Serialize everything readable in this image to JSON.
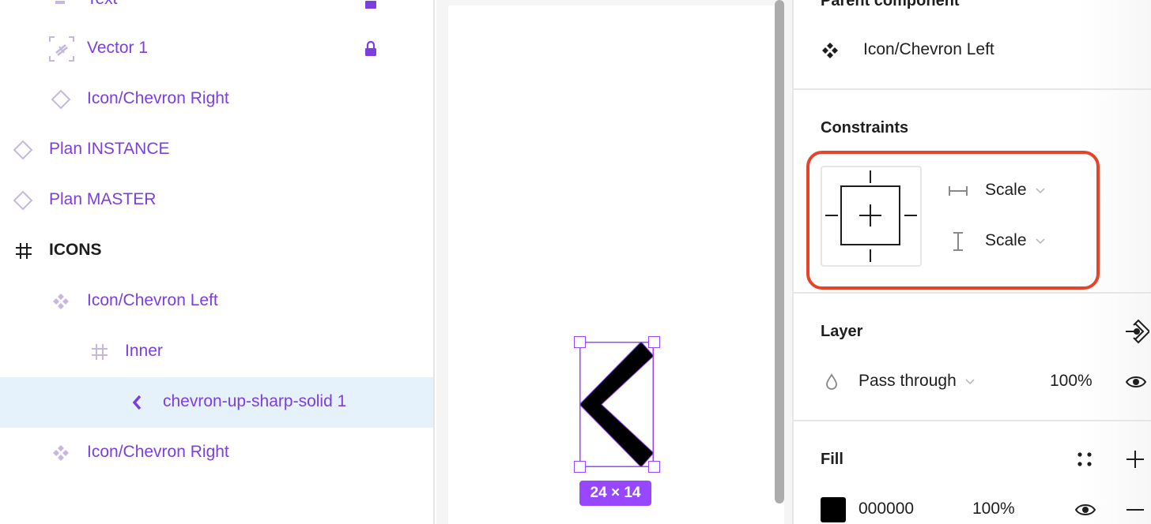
{
  "layers_panel": {
    "items": [
      {
        "label": "Text",
        "icon": "text-layer-icon",
        "locked": true
      },
      {
        "label": "Vector 1",
        "icon": "vector-layer-icon",
        "locked": true
      },
      {
        "label": "Icon/Chevron Right",
        "icon": "instance-icon",
        "locked": false
      },
      {
        "label": "Plan INSTANCE",
        "icon": "instance-icon",
        "locked": false
      },
      {
        "label": "Plan MASTER",
        "icon": "instance-icon",
        "locked": false
      },
      {
        "label": "ICONS",
        "icon": "frame-icon",
        "locked": false
      },
      {
        "label": "Icon/Chevron Left",
        "icon": "component-icon",
        "locked": false
      },
      {
        "label": "Inner",
        "icon": "frame-icon",
        "locked": false
      },
      {
        "label": "chevron-up-sharp-solid 1",
        "icon": "chevron-left-icon",
        "locked": false,
        "selected": true
      },
      {
        "label": "Icon/Chevron Right",
        "icon": "component-icon",
        "locked": false
      }
    ]
  },
  "canvas": {
    "selection_dimensions": "24 × 14",
    "selection_color": "#9747ff"
  },
  "properties": {
    "parent_component": {
      "title": "Parent component",
      "name": "Icon/Chevron Left"
    },
    "constraints": {
      "title": "Constraints",
      "horizontal": "Scale",
      "vertical": "Scale",
      "highlight_color": "#e5432a"
    },
    "layer": {
      "title": "Layer",
      "blend_mode": "Pass through",
      "opacity": "100%"
    },
    "fill": {
      "title": "Fill",
      "color_hex": "000000",
      "swatch_color": "#000000",
      "opacity": "100%"
    }
  },
  "colors": {
    "accent_purple": "#7b3fe0",
    "selected_row_bg": "#e5f2fc",
    "icon_muted_purple": "#c5b7df"
  }
}
